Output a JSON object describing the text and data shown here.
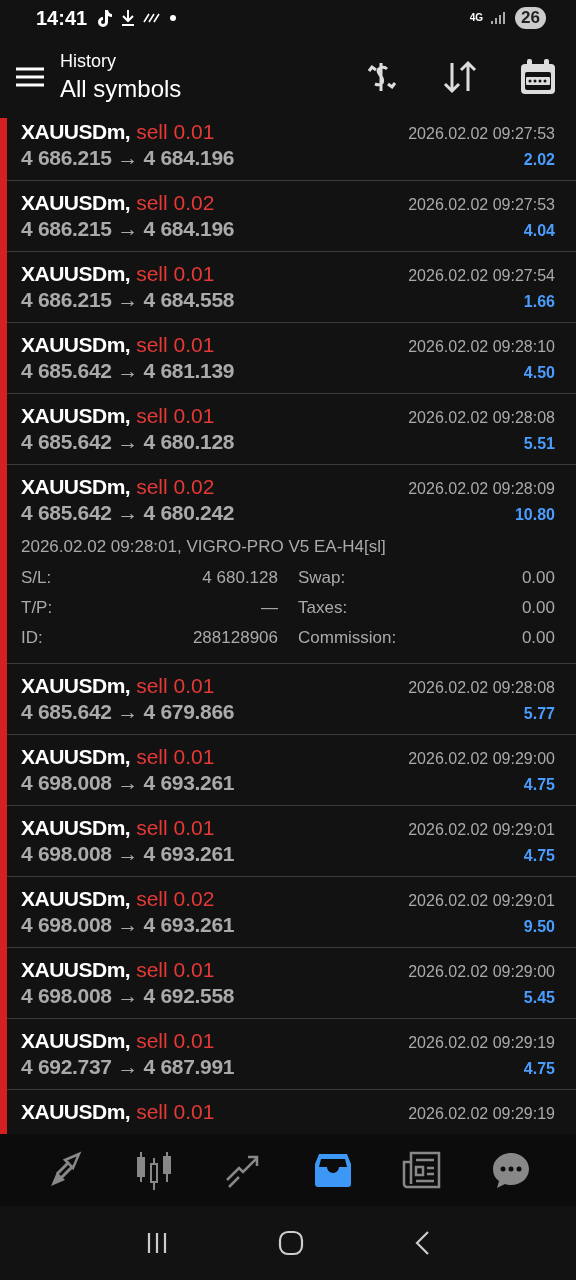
{
  "status_bar": {
    "time": "14:41",
    "network": "4G",
    "battery": "26"
  },
  "header": {
    "title": "History",
    "subtitle": "All symbols"
  },
  "deals": [
    {
      "symbol": "XAUUSDm,",
      "order": "sell 0.01",
      "prices": "4 686.215 → 4 684.196",
      "time": "2026.02.02 09:27:53",
      "profit": "2.02"
    },
    {
      "symbol": "XAUUSDm,",
      "order": "sell 0.02",
      "prices": "4 686.215 → 4 684.196",
      "time": "2026.02.02 09:27:53",
      "profit": "4.04"
    },
    {
      "symbol": "XAUUSDm,",
      "order": "sell 0.01",
      "prices": "4 686.215 → 4 684.558",
      "time": "2026.02.02 09:27:54",
      "profit": "1.66"
    },
    {
      "symbol": "XAUUSDm,",
      "order": "sell 0.01",
      "prices": "4 685.642 → 4 681.139",
      "time": "2026.02.02 09:28:10",
      "profit": "4.50"
    },
    {
      "symbol": "XAUUSDm,",
      "order": "sell 0.01",
      "prices": "4 685.642 → 4 680.128",
      "time": "2026.02.02 09:28:08",
      "profit": "5.51"
    },
    {
      "symbol": "XAUUSDm,",
      "order": "sell 0.02",
      "prices": "4 685.642 → 4 680.242",
      "time": "2026.02.02 09:28:09",
      "profit": "10.80",
      "details": {
        "comment": "2026.02.02 09:28:01, VIGRO-PRO V5 EA-H4[sl]",
        "fields": [
          {
            "label": "S/L:",
            "value": "4 680.128"
          },
          {
            "label": "Swap:",
            "value": "0.00"
          },
          {
            "label": "T/P:",
            "value": "—"
          },
          {
            "label": "Taxes:",
            "value": "0.00"
          },
          {
            "label": "ID:",
            "value": "288128906"
          },
          {
            "label": "Commission:",
            "value": "0.00"
          }
        ]
      }
    },
    {
      "symbol": "XAUUSDm,",
      "order": "sell 0.01",
      "prices": "4 685.642 → 4 679.866",
      "time": "2026.02.02 09:28:08",
      "profit": "5.77"
    },
    {
      "symbol": "XAUUSDm,",
      "order": "sell 0.01",
      "prices": "4 698.008 → 4 693.261",
      "time": "2026.02.02 09:29:00",
      "profit": "4.75"
    },
    {
      "symbol": "XAUUSDm,",
      "order": "sell 0.01",
      "prices": "4 698.008 → 4 693.261",
      "time": "2026.02.02 09:29:01",
      "profit": "4.75"
    },
    {
      "symbol": "XAUUSDm,",
      "order": "sell 0.02",
      "prices": "4 698.008 → 4 693.261",
      "time": "2026.02.02 09:29:01",
      "profit": "9.50"
    },
    {
      "symbol": "XAUUSDm,",
      "order": "sell 0.01",
      "prices": "4 698.008 → 4 692.558",
      "time": "2026.02.02 09:29:00",
      "profit": "5.45"
    },
    {
      "symbol": "XAUUSDm,",
      "order": "sell 0.01",
      "prices": "4 692.737 → 4 687.991",
      "time": "2026.02.02 09:29:19",
      "profit": "4.75"
    },
    {
      "symbol": "XAUUSDm,",
      "order": "sell 0.01",
      "time": "2026.02.02 09:29:19"
    }
  ],
  "bottom_nav": [
    {
      "kind": "quotes",
      "selected": false
    },
    {
      "kind": "chart",
      "selected": false
    },
    {
      "kind": "trade",
      "selected": false
    },
    {
      "kind": "history",
      "selected": true
    },
    {
      "kind": "news",
      "selected": false
    },
    {
      "kind": "chat",
      "selected": false
    }
  ]
}
